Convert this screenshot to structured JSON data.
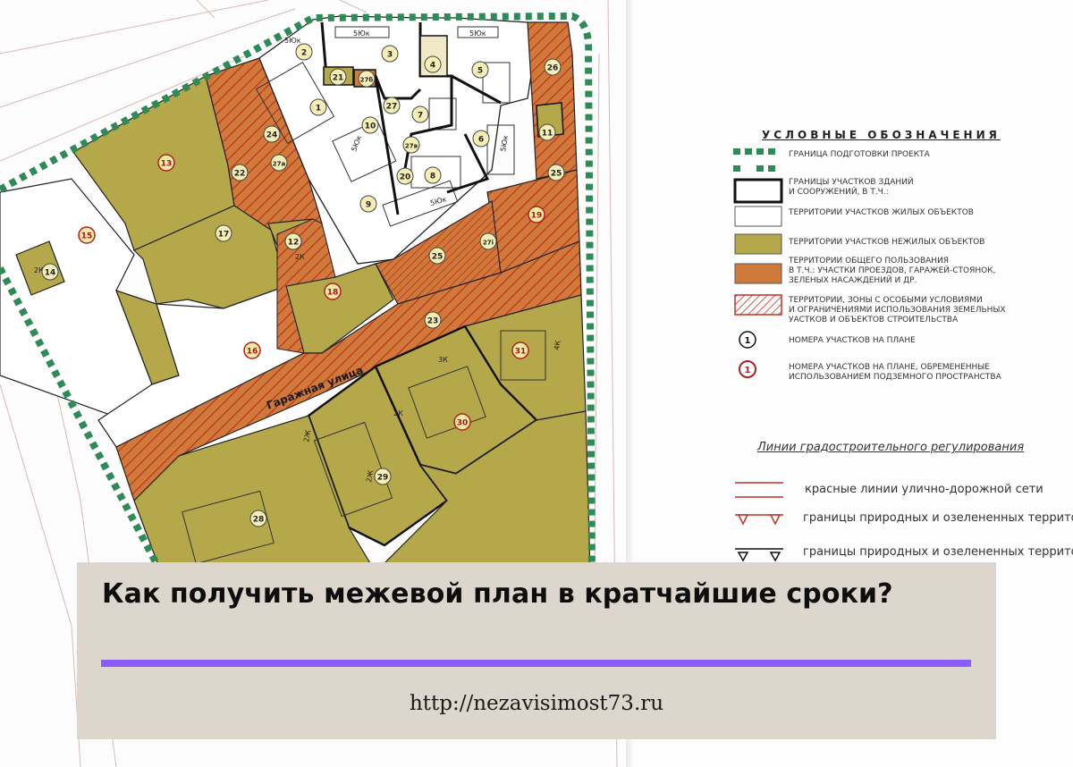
{
  "card": {
    "title": "Как получить межевой план в кратчайшие сроки?",
    "url": "http://nezavisimost73.ru",
    "accent_color": "#8b5cf6",
    "background": "#dcd6cd"
  },
  "map": {
    "street_label": "Гаражная улица",
    "colors": {
      "nonresidential": "#b5a84a",
      "common": "#cf7a3a",
      "hatch": "#c03020",
      "boundary": "#2e8b57",
      "residential": "#ffffff"
    },
    "parcels": {
      "p1": "1",
      "p2": "2",
      "p3": "3",
      "p4": "4",
      "p5": "5",
      "p6": "6",
      "p7": "7",
      "p8": "8",
      "p9": "9",
      "p10": "10",
      "p11": "11",
      "p12": "12",
      "p13": "13",
      "p14": "14",
      "p15": "15",
      "p16": "16",
      "p17": "17",
      "p18": "18",
      "p19": "19",
      "p20": "20",
      "p21": "21",
      "p22": "22",
      "p23": "23",
      "p24": "24",
      "p25": "25",
      "p25b": "25",
      "p26": "26",
      "p27": "27",
      "p27a": "27а",
      "p27b": "27б",
      "p27v": "27в",
      "p27i": "27і",
      "p27i2": "27і",
      "p28": "28",
      "p29": "29",
      "p30": "30",
      "p31": "31"
    },
    "building_labels": [
      "5Юк",
      "5Юк",
      "5Юк",
      "5Юк",
      "5Юк",
      "5Юк",
      "2К",
      "2К",
      "3К",
      "4К",
      "2Ж",
      "2Ж",
      "2К"
    ]
  },
  "legend": {
    "title": "УСЛОВНЫЕ ОБОЗНАЧЕНИЯ",
    "items": [
      "ГРАНИЦА ПОДГОТОВКИ ПРОЕКТА",
      "ГРАНИЦЫ УЧАСТКОВ ЗДАНИЙ\nИ СООРУЖЕНИЙ, В Т.Ч.:",
      "ТЕРРИТОРИИ УЧАСТКОВ ЖИЛЫХ ОБЪЕКТОВ",
      "ТЕРРИТОРИИ УЧАСТКОВ НЕЖИЛЫХ ОБЪЕКТОВ",
      "ТЕРРИТОРИИ ОБЩЕГО ПОЛЬЗОВАНИЯ\nВ Т.Ч.: УЧАСТКИ ПРОЕЗДОВ, ГАРАЖЕЙ-СТОЯНОК,\nЗЕЛЕНЫХ НАСАЖДЕНИЙ И ДР.",
      "ТЕРРИТОРИИ, ЗОНЫ С ОСОБЫМИ УСЛОВИЯМИ\nИ ОГРАНИЧЕНИЯМИ ИСПОЛЬЗОВАНИЯ ЗЕМЕЛЬНЫХ\nУАСТКОВ И ОБЪЕКТОВ СТРОИТЕЛЬСТВА",
      "НОМЕРА УЧАСТКОВ НА ПЛАНЕ",
      "НОМЕРА УЧАСТКОВ НА ПЛАНЕ, ОБРЕМЕНЕННЫЕ\nИСПОЛЬЗОВАНИЕМ ПОДЗЕМНОГО ПРОСТРАНСТВА"
    ],
    "marker_number": "1",
    "lines_title": "Линии градостроительного регулирования",
    "lines": [
      "красные линии улично-дорожной сети",
      "границы  природных и озелененных террито",
      "границы  природных и озелененных террито"
    ]
  }
}
